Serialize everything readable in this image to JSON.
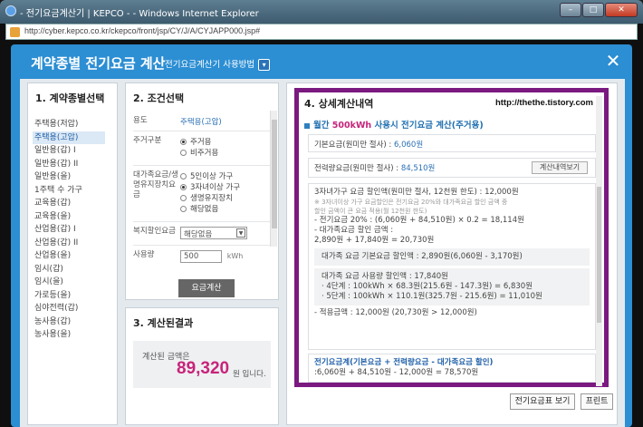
{
  "browser": {
    "title": "- 전기요금계산기 | KEPCO - - Windows Internet Explorer",
    "address": "http://cyber.kepco.co.kr/ckepco/front/jsp/CY/J/A/CYJAPP000.jsp#",
    "btn_min": "–",
    "btn_max": "□",
    "btn_close": "✕"
  },
  "modal": {
    "title": "계약종별 전기요금 계산",
    "help_label": "전기요금계산기 사용방법",
    "help_icon": "chevron-down-icon",
    "close_label": "✕"
  },
  "panel1": {
    "heading": "1. 계약종별선택",
    "items": [
      {
        "label": "주택용(저압)",
        "selected": false
      },
      {
        "label": "주택용(고압)",
        "selected": true
      },
      {
        "label": "일반용(갑) I",
        "selected": false
      },
      {
        "label": "일반용(갑) II",
        "selected": false
      },
      {
        "label": "일반용(을)",
        "selected": false
      },
      {
        "label": "1주택 수 가구",
        "selected": false
      },
      {
        "label": "교육용(갑)",
        "selected": false
      },
      {
        "label": "교육용(을)",
        "selected": false
      },
      {
        "label": "산업용(갑) I",
        "selected": false
      },
      {
        "label": "산업용(갑) II",
        "selected": false
      },
      {
        "label": "산업용(을)",
        "selected": false
      },
      {
        "label": "임시(갑)",
        "selected": false
      },
      {
        "label": "임시(을)",
        "selected": false
      },
      {
        "label": "가로등(을)",
        "selected": false
      },
      {
        "label": "심야전력(갑)",
        "selected": false
      },
      {
        "label": "농사용(갑)",
        "selected": false
      },
      {
        "label": "농사용(을)",
        "selected": false
      }
    ]
  },
  "panel2": {
    "heading": "2. 조건선택",
    "usage_label": "용도",
    "usage_value": "주택용(고압)",
    "residence_label": "주거구분",
    "residence_options": [
      "주거용",
      "비주거용"
    ],
    "family_label": "대가족요금/생명유지장치요금",
    "family_options": [
      "5인이상 가구",
      "3자녀이상 가구",
      "생명유지장치",
      "해당없음"
    ],
    "welfare_label": "복지할인요금",
    "welfare_value": "해당없음",
    "usage_amount_label": "사용량",
    "usage_amount_value": "500",
    "usage_amount_unit": "kWh",
    "calc_button": "요금계산"
  },
  "panel3": {
    "heading": "3. 계산된결과",
    "result_label": "계산된 금액은",
    "result_amount": "89,320",
    "result_unit": "원 입니다."
  },
  "panel4": {
    "heading": "4. 상세계산내역",
    "watermark": "http://thethe.tistory.com",
    "subtitle_pre": "월간 ",
    "subtitle_hl": "500kWh",
    "subtitle_post": " 사용시 전기요금 계산(주거용)",
    "basic_fee_label": "기본요금(원미만 절사) : ",
    "basic_fee_value": "6,060원",
    "energy_fee_label": "전력량요금(원미만 절사) : ",
    "energy_fee_value": "84,510원",
    "detail_button": "계산내역보기",
    "discount_title": "3자녀가구 요금 할인액(원미만 절사, 12천원 한도) : 12,000원",
    "discount_note1": "※ 3자녀이상 가구 요금할인은 전기요금 20%와 대가족요금 할인 금액 중",
    "discount_note2": "할인 금액이 큰 요금 적용(월 12천원 한도)",
    "discount_line1": "- 전기요금 20% : (6,060원 + 84,510원) × 0.2 = 18,114원",
    "discount_line2": "- 대가족요금 할인 금액 :",
    "discount_line3": "2,890원 + 17,840원 = 20,730원",
    "family_basic": "대가족 요금 기본요금 할인액 : 2,890원(6,060원 - 3,170원)",
    "family_usage_title": "대가족 요금 사용량 할인액 : 17,840원",
    "family_usage_line1": "· 4단계 : 100kWh × 68.3원(215.6원 - 147.3원) = 6,830원",
    "family_usage_line2": "· 5단계 : 100kWh × 110.1원(325.7원 - 215.6원) = 11,010원",
    "applied_line": "- 적용금액 : 12,000원 (20,730원 > 12,000원)",
    "total_title": "전기요금계(기본요금 + 전력량요금 - 대가족요금 할인)",
    "total_line": ":6,060원 + 84,510원 - 12,000원 = 78,570원",
    "btn_table": "전기요금표 보기",
    "btn_print": "프린트"
  },
  "colors": {
    "accent": "#2c8ed3",
    "highlight": "#c8237a",
    "frame": "#7a1a80"
  }
}
